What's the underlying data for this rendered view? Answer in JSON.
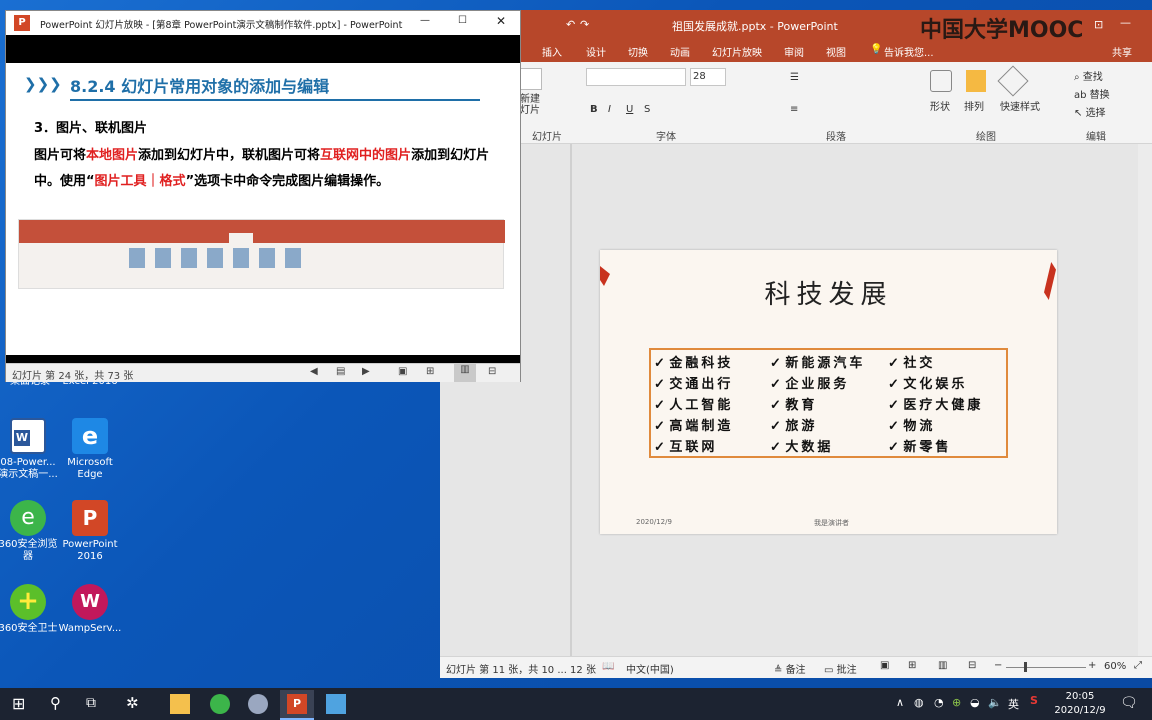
{
  "desktop": {
    "icons_top_row": [
      "桌面记录",
      "Excel 2016"
    ],
    "icons": [
      {
        "label": "08-Power... 演示文稿一...",
        "color": "#2b579a"
      },
      {
        "label": "Microsoft Edge",
        "color": "#1e88e5"
      },
      {
        "label": "360安全浏览器",
        "color": "#3cb54a"
      },
      {
        "label": "PowerPoint 2016",
        "color": "#d24726"
      },
      {
        "label": "360安全卫士",
        "color": "#5bbf2a"
      },
      {
        "label": "WampServ...",
        "color": "#c2185b"
      }
    ]
  },
  "ppt": {
    "title": "祖国发展成就.pptx - PowerPoint",
    "tabs": [
      "插入",
      "设计",
      "切换",
      "动画",
      "幻灯片放映",
      "审阅",
      "视图"
    ],
    "tell_me": "告诉我您...",
    "share": "共享",
    "watermark": "中国大学MOOC",
    "ribbon": {
      "new_slide": "新建\n灯片",
      "font_size": "28",
      "groups": [
        "幻灯片",
        "字体",
        "段落",
        "绘图",
        "编辑"
      ],
      "shape_btn": "形状",
      "arrange_btn": "排列",
      "quick_style_btn": "快速样式",
      "find": "查找",
      "replace": "替换",
      "select": "选择"
    },
    "slide": {
      "title": "科技发展",
      "items_col1": [
        "金融科技",
        "交通出行",
        "人工智能",
        "高端制造",
        "互联网"
      ],
      "items_col2": [
        "新能源汽车",
        "企业服务",
        "教育",
        "旅游",
        "大数据"
      ],
      "items_col3": [
        "社交",
        "文化娱乐",
        "医疗大健康",
        "物流",
        "新零售"
      ],
      "check": "✓",
      "date": "2020/12/9",
      "footer": "我是演讲者"
    },
    "status": {
      "slide_info": "幻灯片 第 11 张，共 10 ... 12 张",
      "language": "中文(中国)",
      "notes": "备注",
      "comments": "批注",
      "zoom": "60%"
    }
  },
  "slideshow": {
    "title": "PowerPoint 幻灯片放映 - [第8章 PowerPoint演示文稿制作软件.pptx] - PowerPoint",
    "heading": "8.2.4  幻灯片常用对象的添加与编辑",
    "subheading": "3．图片、联机图片",
    "para_parts": [
      {
        "text": "图片可将",
        "red": false
      },
      {
        "text": "本地图片",
        "red": true
      },
      {
        "text": "添加到幻灯片中，联机图片可将",
        "red": false
      },
      {
        "text": "互联网中的图片",
        "red": true
      },
      {
        "text": "添加到幻灯片中。使用“",
        "red": false
      },
      {
        "text": "图片工具｜格式",
        "red": true
      },
      {
        "text": "”选项卡中命令完成图片编辑操作。",
        "red": false
      }
    ],
    "status": "幻灯片 第 24 张，共 73 张"
  },
  "taskbar": {
    "time": "20:05",
    "date": "2020/12/9",
    "ime": "英"
  },
  "colors": {
    "ppt_accent": "#b7472a",
    "heading_blue": "#1f6fa8",
    "red_text": "#e02020",
    "slide_border": "#e08a3c"
  }
}
